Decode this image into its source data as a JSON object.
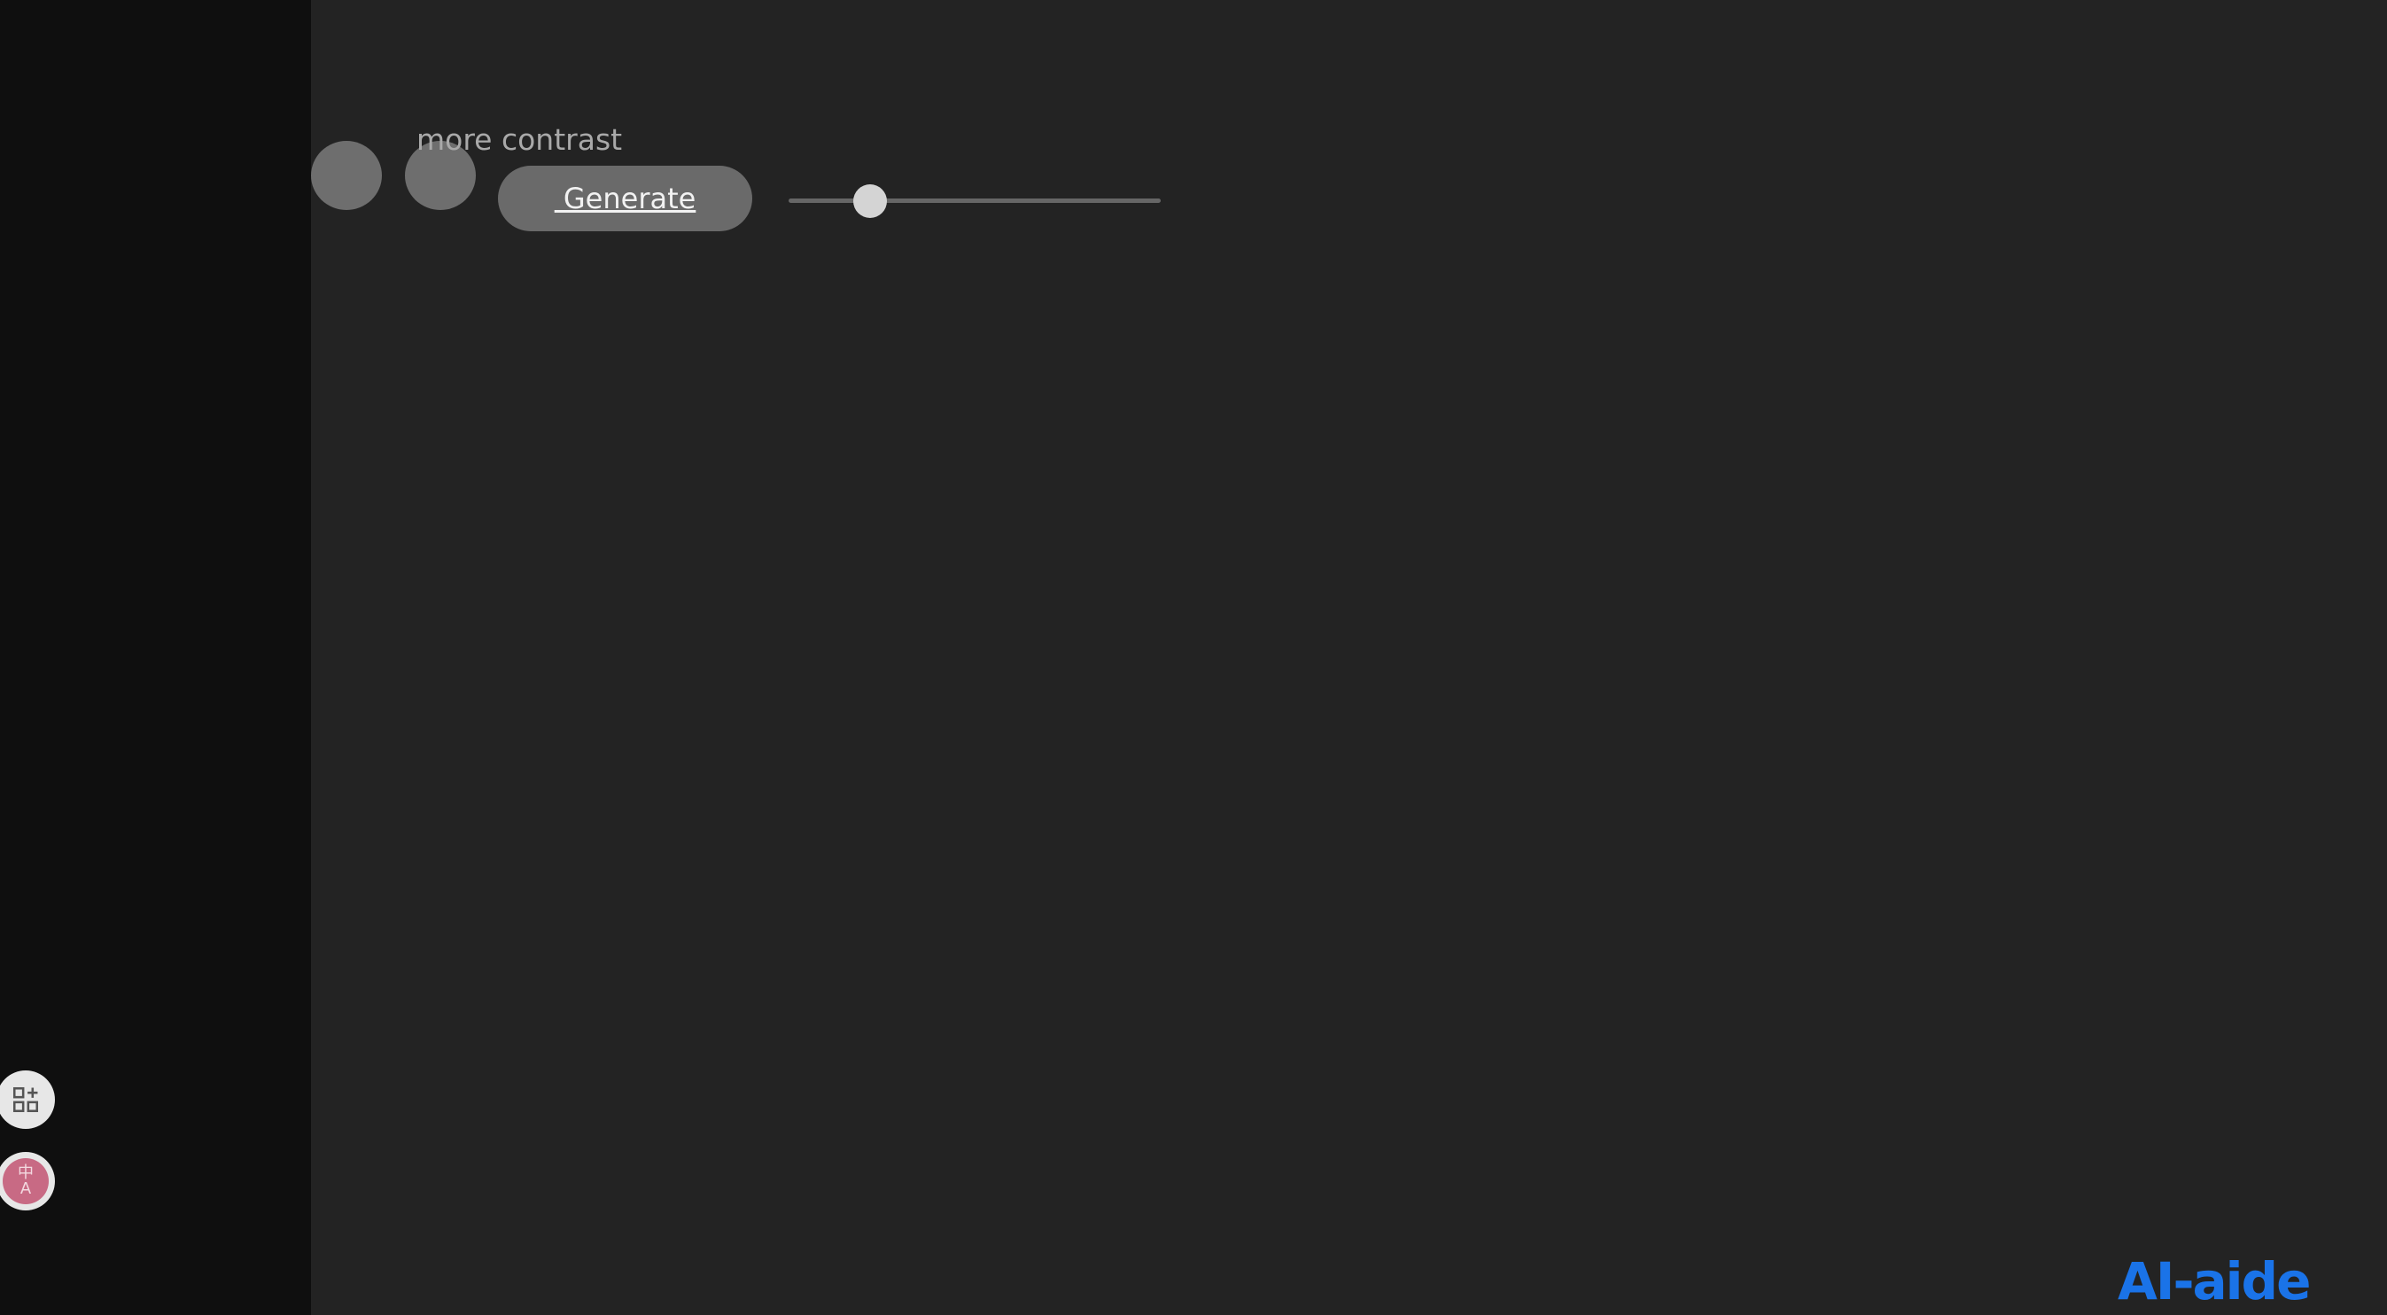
{
  "controls": {
    "label": "more contrast",
    "generate_label": " Generate",
    "slider_value": 0.22
  },
  "floating": {
    "apps_icon": "apps-add-icon",
    "translate_icon": "translate-icon",
    "translate_top": "中",
    "translate_bottom": "A"
  },
  "brand": {
    "logo_text": "AI-aide",
    "color": "#1a73e8"
  },
  "colors": {
    "sidebar": "#0f0f0f",
    "main": "#232323",
    "button": "#6a6a6a",
    "translate_accent": "#c86a84"
  }
}
